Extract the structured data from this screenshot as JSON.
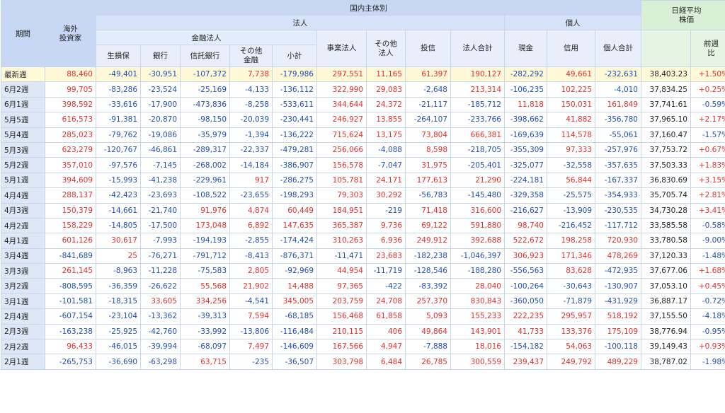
{
  "header": {
    "period": "期間",
    "foreign": "海外\n投資家",
    "domestic": "国内主体別",
    "corporate": "法人",
    "individual": "個人",
    "financial": "金融法人",
    "nikkei": "日経平均\n株価",
    "cols": [
      "生損保",
      "銀行",
      "信託銀行",
      "その他\n金融",
      "小計",
      "事業法人",
      "その他\n法人",
      "投信",
      "法人合計",
      "現金",
      "信用",
      "個人合計"
    ],
    "change": "前週\n比"
  },
  "rows": [
    {
      "label": "最新週",
      "values": [
        "88,460",
        "-49,401",
        "-30,951",
        "-107,372",
        "7,738",
        "-179,986",
        "297,551",
        "11,165",
        "61,397",
        "190,127",
        "-282,292",
        "49,661",
        "-232,631"
      ],
      "nikkei": "38,403.23",
      "change": "+1.50%"
    },
    {
      "label": "6月2週",
      "values": [
        "99,705",
        "-83,286",
        "-23,524",
        "-25,169",
        "-4,133",
        "-136,112",
        "322,990",
        "29,083",
        "-2,648",
        "213,314",
        "-106,235",
        "102,225",
        "-4,010"
      ],
      "nikkei": "37,834.25",
      "change": "+0.25%"
    },
    {
      "label": "6月1週",
      "values": [
        "398,592",
        "-33,616",
        "-17,900",
        "-473,836",
        "-8,258",
        "-533,611",
        "344,644",
        "24,372",
        "-21,117",
        "-185,712",
        "11,818",
        "150,031",
        "161,849"
      ],
      "nikkei": "37,741.61",
      "change": "-0.59%"
    },
    {
      "label": "5月5週",
      "values": [
        "616,573",
        "-91,381",
        "-20,870",
        "-98,150",
        "-20,039",
        "-230,441",
        "246,927",
        "13,855",
        "-264,107",
        "-233,766",
        "-398,662",
        "41,882",
        "-356,780"
      ],
      "nikkei": "37,965.10",
      "change": "+2.17%"
    },
    {
      "label": "5月4週",
      "values": [
        "285,023",
        "-79,762",
        "-19,086",
        "-35,979",
        "-1,394",
        "-136,222",
        "715,624",
        "13,175",
        "73,804",
        "666,381",
        "-169,639",
        "114,578",
        "-55,061"
      ],
      "nikkei": "37,160.47",
      "change": "-1.57%"
    },
    {
      "label": "5月3週",
      "values": [
        "623,279",
        "-120,767",
        "-46,861",
        "-289,317",
        "-22,337",
        "-479,281",
        "256,066",
        "-4,088",
        "8,598",
        "-218,705",
        "-355,309",
        "97,333",
        "-257,976"
      ],
      "nikkei": "37,753.72",
      "change": "+0.67%"
    },
    {
      "label": "5月2週",
      "values": [
        "357,010",
        "-97,576",
        "-7,145",
        "-268,002",
        "-14,184",
        "-386,907",
        "156,578",
        "-7,047",
        "31,975",
        "-205,401",
        "-325,077",
        "-32,558",
        "-357,635"
      ],
      "nikkei": "37,503.33",
      "change": "+1.83%"
    },
    {
      "label": "5月1週",
      "values": [
        "394,609",
        "-15,993",
        "-41,238",
        "-229,961",
        "917",
        "-286,275",
        "105,781",
        "24,171",
        "177,613",
        "21,290",
        "-224,181",
        "56,844",
        "-167,337"
      ],
      "nikkei": "36,830.69",
      "change": "+3.15%"
    },
    {
      "label": "4月4週",
      "values": [
        "288,137",
        "-42,423",
        "-23,693",
        "-108,522",
        "-23,655",
        "-198,293",
        "79,303",
        "30,292",
        "-56,783",
        "-145,480",
        "-329,358",
        "-25,575",
        "-354,933"
      ],
      "nikkei": "35,705.74",
      "change": "+2.81%"
    },
    {
      "label": "4月3週",
      "values": [
        "150,379",
        "-14,661",
        "-21,740",
        "91,976",
        "4,874",
        "60,449",
        "184,951",
        "-219",
        "71,418",
        "316,600",
        "-216,627",
        "-13,909",
        "-230,535"
      ],
      "nikkei": "34,730.28",
      "change": "+3.41%"
    },
    {
      "label": "4月2週",
      "values": [
        "158,229",
        "-14,805",
        "-17,500",
        "173,048",
        "6,892",
        "147,635",
        "365,387",
        "9,736",
        "69,122",
        "591,880",
        "98,740",
        "-216,452",
        "-117,712"
      ],
      "nikkei": "33,585.58",
      "change": "-0.58%"
    },
    {
      "label": "4月1週",
      "values": [
        "601,126",
        "30,617",
        "-7,993",
        "-194,193",
        "-2,855",
        "-174,424",
        "310,263",
        "6,936",
        "249,912",
        "392,688",
        "522,672",
        "198,258",
        "720,930"
      ],
      "nikkei": "33,780.58",
      "change": "-9.00%"
    },
    {
      "label": "3月4週",
      "values": [
        "-841,689",
        "25",
        "-76,271",
        "-791,712",
        "-8,413",
        "-876,371",
        "-11,471",
        "23,683",
        "-182,238",
        "-1,046,397",
        "306,923",
        "171,346",
        "478,269"
      ],
      "nikkei": "37,120.33",
      "change": "-1.48%"
    },
    {
      "label": "3月3週",
      "values": [
        "261,145",
        "-8,963",
        "-11,228",
        "-75,583",
        "2,805",
        "-92,969",
        "44,954",
        "-11,719",
        "-128,546",
        "-188,280",
        "-556,563",
        "83,628",
        "-472,935"
      ],
      "nikkei": "37,677.06",
      "change": "+1.68%"
    },
    {
      "label": "3月2週",
      "values": [
        "-808,595",
        "-36,359",
        "-26,622",
        "55,568",
        "21,902",
        "14,488",
        "97,365",
        "-422",
        "-83,392",
        "28,040",
        "-100,264",
        "-30,643",
        "-130,907"
      ],
      "nikkei": "37,053.10",
      "change": "+0.45%"
    },
    {
      "label": "3月1週",
      "values": [
        "-101,581",
        "-18,315",
        "33,605",
        "334,256",
        "-4,541",
        "345,005",
        "203,759",
        "24,708",
        "257,370",
        "830,843",
        "-360,050",
        "-71,879",
        "-431,929"
      ],
      "nikkei": "36,887.17",
      "change": "-0.72%"
    },
    {
      "label": "2月4週",
      "values": [
        "-607,154",
        "-23,104",
        "-13,362",
        "-39,313",
        "7,594",
        "-68,185",
        "156,468",
        "61,858",
        "5,093",
        "155,233",
        "222,235",
        "295,957",
        "518,192"
      ],
      "nikkei": "37,155.50",
      "change": "-4.18%"
    },
    {
      "label": "2月3週",
      "values": [
        "-163,238",
        "-25,925",
        "-42,760",
        "-33,992",
        "-13,806",
        "-116,484",
        "210,115",
        "406",
        "49,864",
        "143,901",
        "41,733",
        "133,376",
        "175,109"
      ],
      "nikkei": "38,776.94",
      "change": "-0.95%"
    },
    {
      "label": "2月2週",
      "values": [
        "96,433",
        "-46,015",
        "-39,994",
        "-68,097",
        "7,497",
        "-146,609",
        "167,566",
        "4,947",
        "-7,888",
        "18,016",
        "-154,182",
        "54,063",
        "-100,118"
      ],
      "nikkei": "39,149.43",
      "change": "+0.93%"
    },
    {
      "label": "2月1週",
      "values": [
        "-265,753",
        "-36,690",
        "-63,298",
        "63,715",
        "-235",
        "-36,507",
        "303,798",
        "6,484",
        "26,785",
        "300,559",
        "239,437",
        "249,792",
        "489,229"
      ],
      "nikkei": "38,787.02",
      "change": "-1.98%"
    }
  ],
  "colors": {
    "positive": "#e0302e",
    "negative": "#1f4fb4"
  }
}
